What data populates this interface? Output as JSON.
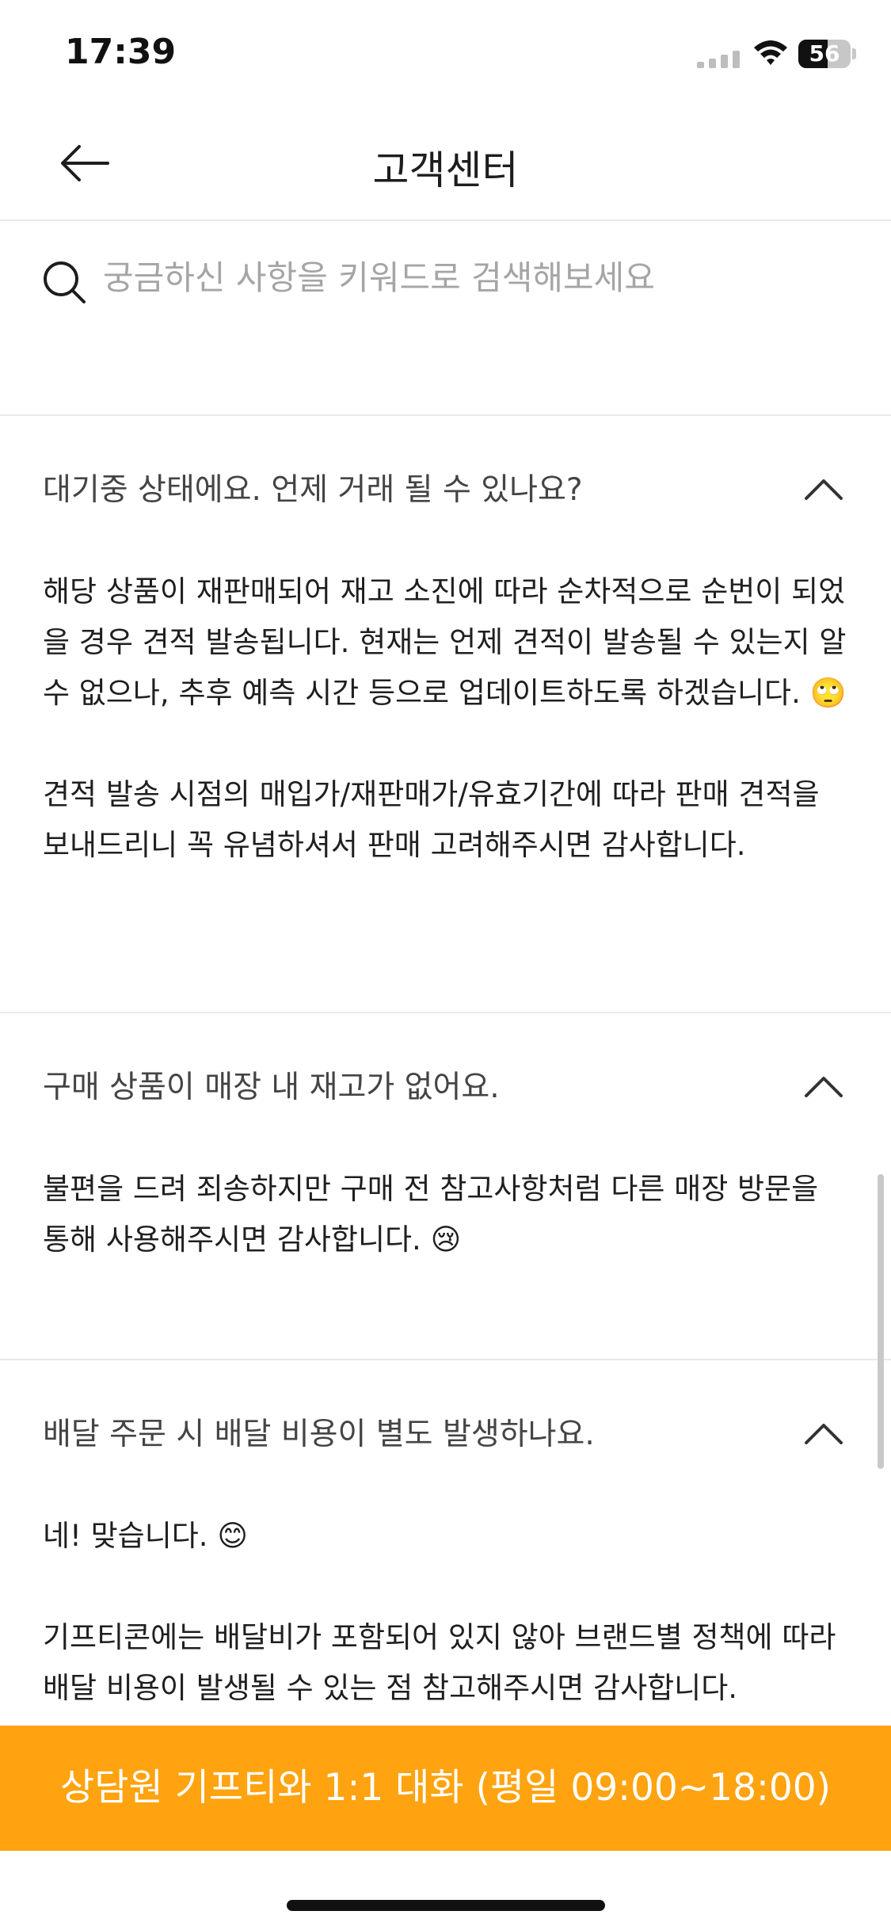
{
  "status_bar": {
    "time": "17:39",
    "battery_level": "56",
    "battery_fraction": 0.56,
    "icons": [
      "cellular-signal-icon",
      "wifi-icon",
      "battery-icon"
    ]
  },
  "header": {
    "title": "고객센터",
    "back_icon": "arrow-left-icon"
  },
  "search": {
    "placeholder": "궁금하신 사항을 키워드로 검색해보세요",
    "value": "",
    "icon": "search-icon"
  },
  "faq": {
    "items": [
      {
        "question": "대기중 상태에요. 언제 거래 될 수 있나요?",
        "expanded": true,
        "answer": [
          "해당 상품이 재판매되어 재고 소진에 따라 순차적으로 순번이 되었을 경우 견적 발송됩니다. 현재는 언제 견적이 발송될 수 있는지 알 수 없으나, 추후 예측 시간 등으로 업데이트하도록 하겠습니다. 🙄",
          "견적 발송 시점의 매입가/재판매가/유효기간에 따라 판매 견적을 보내드리니 꼭 유념하셔서 판매 고려해주시면 감사합니다."
        ]
      },
      {
        "question": "구매 상품이 매장 내 재고가 없어요.",
        "expanded": true,
        "answer": [
          "불편을 드려 죄송하지만 구매 전 참고사항처럼 다른 매장 방문을 통해 사용해주시면 감사합니다. 😢"
        ]
      },
      {
        "question": "배달 주문 시 배달 비용이 별도 발생하나요.",
        "expanded": true,
        "answer": [
          "네! 맞습니다. 😊",
          "기프티콘에는 배달비가 포함되어 있지 않아 브랜드별 정책에 따라 배달 비용이 발생될 수 있는 점 참고해주시면 감사합니다."
        ]
      }
    ]
  },
  "cta": {
    "label": "상담원 기프티와 1:1 대화 (평일 09:00~18:00)"
  },
  "colors": {
    "accent": "#ffa310",
    "divider": "#e9e9e9",
    "placeholder": "#a5a5a5"
  }
}
